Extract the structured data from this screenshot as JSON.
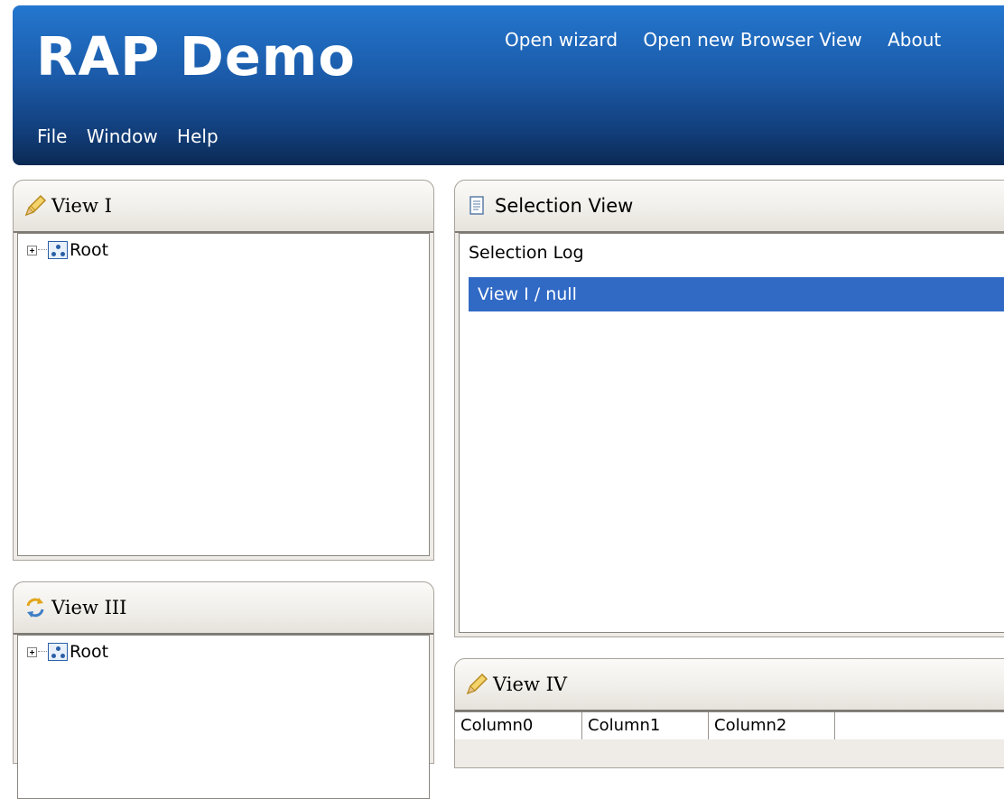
{
  "header": {
    "app_title": "RAP Demo",
    "links": [
      "Open wizard",
      "Open new Browser View",
      "About"
    ],
    "menu": [
      "File",
      "Window",
      "Help"
    ]
  },
  "views": {
    "view1": {
      "title": "View I",
      "tree": [
        {
          "label": "Root"
        }
      ]
    },
    "view3": {
      "title": "View III",
      "tree": [
        {
          "label": "Root"
        }
      ]
    },
    "selection": {
      "title": "Selection View",
      "log_label": "Selection Log",
      "entries": [
        "View I / null"
      ]
    },
    "view4": {
      "title": "View IV",
      "columns": [
        "Column0",
        "Column1",
        "Column2"
      ]
    }
  },
  "colors": {
    "header_gradient_top": "#2377cf",
    "header_gradient_bottom": "#0b2a55",
    "selection_highlight": "#316ac5",
    "panel_frame": "#efebe7"
  },
  "icons": {
    "view1": "pencil-icon",
    "view3": "refresh-icon",
    "selection": "document-icon",
    "view4": "pencil-icon",
    "tree_node": "hierarchy-icon",
    "expander": "plus-box-icon"
  }
}
